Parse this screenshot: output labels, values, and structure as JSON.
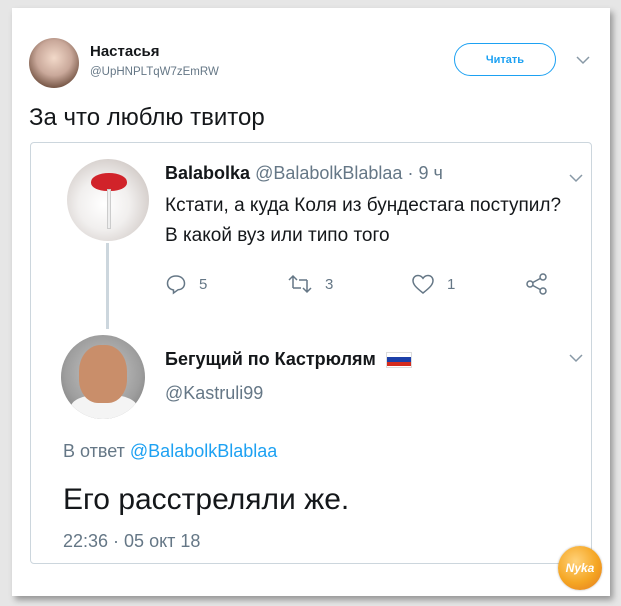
{
  "tweet": {
    "author_name": "Настасья",
    "author_handle": "@UpHNPLTqW7zEmRW",
    "follow_label": "Читать",
    "text": "За что люблю твитор"
  },
  "quoted": {
    "first": {
      "name": "Balabolka",
      "handle": "@BalabolkBlablaa",
      "time": "· 9 ч",
      "text": "Кстати, а куда Коля из бундестага поступил? В какой вуз или типо того",
      "replies": "5",
      "retweets": "3",
      "likes": "1"
    },
    "second": {
      "name": "Бегущий по Кастрюлям",
      "handle": "@Kastruli99",
      "reply_prefix": "В ответ",
      "reply_handle": "@BalabolkBlablaa",
      "text": "Его расстреляли же.",
      "timestamp": "22:36 · 05 окт 18"
    }
  },
  "watermark": {
    "text": "Nyka"
  },
  "colors": {
    "accent": "#1da1f2",
    "muted": "#657786",
    "border": "#ccd6dd"
  }
}
